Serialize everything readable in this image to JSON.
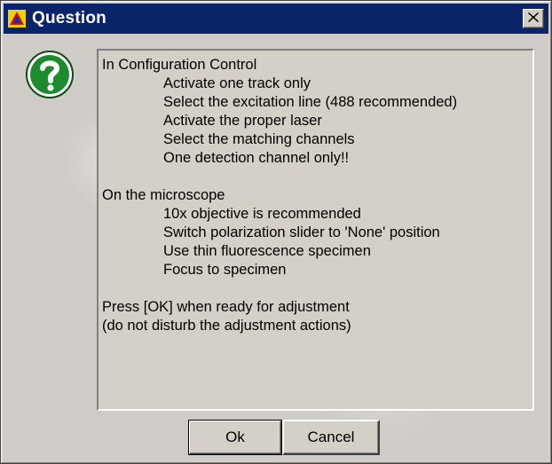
{
  "window": {
    "title": "Question",
    "title_icon": "app-triangle-icon",
    "close_icon": "close-x-icon"
  },
  "dialog": {
    "icon": "question-mark-icon",
    "sections": [
      {
        "heading": "In Configuration Control",
        "items": [
          "Activate one track only",
          "Select the excitation line (488 recommended)",
          "Activate the proper laser",
          "Select the matching channels",
          "One detection channel only!!"
        ]
      },
      {
        "heading": "On the microscope",
        "items": [
          "10x objective is recommended",
          "Switch polarization slider to 'None' position",
          "Use thin fluorescence specimen",
          "Focus to specimen"
        ]
      }
    ],
    "footer_lines": [
      "Press [OK] when ready for adjustment",
      "(do not disturb the adjustment actions)"
    ]
  },
  "buttons": {
    "ok_label": "Ok",
    "cancel_label": "Cancel"
  },
  "colors": {
    "titlebar": "#0a246a",
    "face": "#d4d0c8",
    "question_icon_green": "#1e8a2e"
  }
}
